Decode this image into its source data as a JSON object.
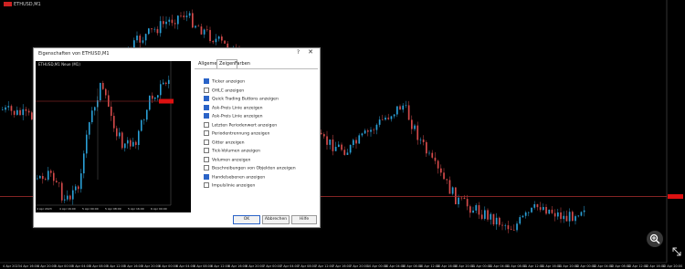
{
  "chart": {
    "title": "ETHUSD,M1",
    "price_labels": [
      "",
      "",
      "",
      "",
      "",
      "",
      "",
      "",
      "",
      "",
      "",
      "",
      "",
      ""
    ],
    "current_price_label": "",
    "time_labels": [
      "4 Apr 2023",
      "4 Apr 16:00",
      "4 Apr 20:00",
      "5 Apr 00:00",
      "5 Apr 04:00",
      "5 Apr 08:00",
      "5 Apr 12:00",
      "5 Apr 16:00",
      "5 Apr 20:00",
      "6 Apr 00:00",
      "6 Apr 04:00",
      "6 Apr 08:00",
      "6 Apr 12:00",
      "6 Apr 16:00",
      "6 Apr 20:00",
      "7 Apr 00:00",
      "7 Apr 04:00",
      "7 Apr 08:00",
      "7 Apr 12:00",
      "7 Apr 16:00",
      "7 Apr 20:00",
      "10 Apr 00:00",
      "10 Apr 04:00",
      "10 Apr 08:00",
      "10 Apr 12:00",
      "10 Apr 16:00",
      "10 Apr 20:00",
      "11 Apr 00:00",
      "11 Apr 04:00",
      "11 Apr 08:00",
      "11 Apr 12:00",
      "11 Apr 16:00",
      "11 Apr 20:00",
      "12 Apr 00:00",
      "12 Apr 04:00",
      "12 Apr 08:00",
      "12 Apr 12:00",
      "12 Apr 16:00",
      "12 Apr 20:00"
    ],
    "colors": {
      "bull": "#2a9fd6",
      "bear": "#d44a4a",
      "price_line": "#b03030",
      "background": "#000000",
      "text": "#cfcfcf"
    }
  },
  "dialog": {
    "title": "Eigenschaften von ETHUSD,M1",
    "help_label": "?",
    "close_label": "✕",
    "preview_title": "ETHUSD,M1  Neue (M1)",
    "preview_price_labels": [
      "",
      "",
      "",
      "",
      "",
      "",
      "",
      "",
      "",
      "",
      "",
      "",
      "",
      ""
    ],
    "preview_time_labels": [
      "4 Apr 2023",
      "4 Apr 16:00",
      "5 Apr 00:00",
      "5 Apr 08:00",
      "5 Apr 16:00",
      "6 Apr 00:00"
    ],
    "tabs": [
      {
        "label": "Allgemein",
        "active": false
      },
      {
        "label": "Zeigen",
        "active": true
      },
      {
        "label": "Farben",
        "active": false
      }
    ],
    "options": [
      {
        "label": "Ticker anzeigen",
        "checked": true
      },
      {
        "label": "OHLC anzeigen",
        "checked": false
      },
      {
        "label": "Quick Trading Buttons anzeigen",
        "checked": true
      },
      {
        "label": "Ask-Preis Linie anzeigen",
        "checked": true
      },
      {
        "label": "Ask-Preis Linie anzeigen",
        "checked": true
      },
      {
        "label": "Letzten Periodenwert anzeigen",
        "checked": false
      },
      {
        "label": "Periodentrennung anzeigen",
        "checked": false
      },
      {
        "label": "Gitter anzeigen",
        "checked": false
      },
      {
        "label": "Tick-Volumen anzeigen",
        "checked": false
      },
      {
        "label": "Volumen anzeigen",
        "checked": false
      },
      {
        "label": "Beschreibungen von Objekten anzeigen",
        "checked": false
      },
      {
        "label": "Handelsebenen anzeigen",
        "checked": true
      },
      {
        "label": "Impulslinie anzeigen",
        "checked": false
      }
    ],
    "buttons": {
      "ok": "OK",
      "cancel": "Abbrechen",
      "help": "Hilfe"
    }
  }
}
